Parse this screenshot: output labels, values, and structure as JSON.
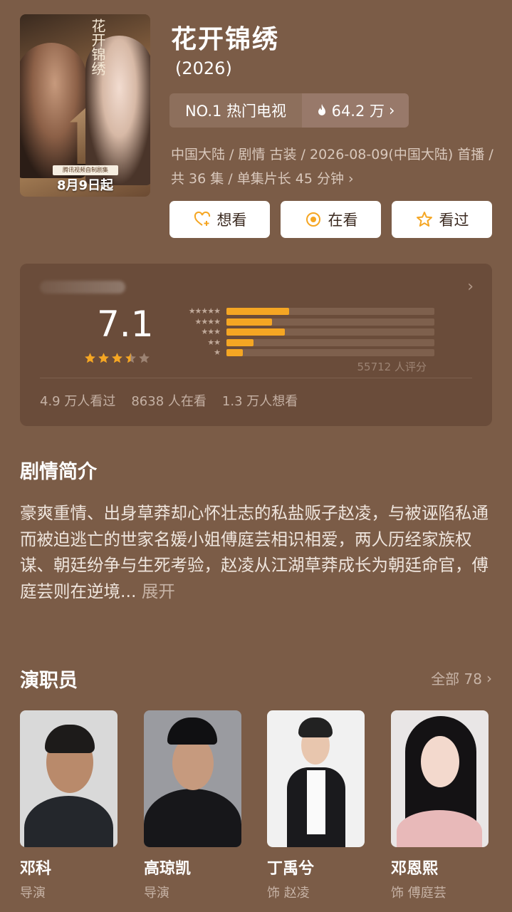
{
  "show": {
    "title": "花开锦绣",
    "year": "(2026)",
    "poster": {
      "calligraphy": "花开锦绣",
      "stripe": "腾讯视频自制剧集",
      "airdate": "8月9日起"
    },
    "rank_label": "NO.1 热门电视",
    "heat_value": "64.2 万",
    "meta_line": "中国大陆 / 剧情 古装 / 2026-08-09(中国大陆) 首播 / 共 36 集 / 单集片长 45 分钟"
  },
  "actions": {
    "want": "想看",
    "watching": "在看",
    "watched": "看过"
  },
  "rating": {
    "score": "7.1",
    "stars_filled": 3.5,
    "distribution": [
      {
        "stars": "★★★★★",
        "fraction": 0.3
      },
      {
        "stars": "★★★★",
        "fraction": 0.22
      },
      {
        "stars": "★★★",
        "fraction": 0.28
      },
      {
        "stars": "★★",
        "fraction": 0.13
      },
      {
        "stars": "★",
        "fraction": 0.08
      }
    ],
    "count": "55712 人评分",
    "seen": "4.9 万人看过",
    "watching": "8638 人在看",
    "want": "1.3 万人想看"
  },
  "synopsis": {
    "title": "剧情简介",
    "text": "豪爽重情、出身草莽却心怀壮志的私盐贩子赵凌，与被诬陷私通而被迫逃亡的世家名媛小姐傅庭芸相识相爱，两人历经家族权谋、朝廷纷争与生死考验，赵凌从江湖草莽成长为朝廷命官，傅庭芸则在逆境...",
    "expand": "展开"
  },
  "cast": {
    "title": "演职员",
    "all": "全部 78",
    "members": [
      {
        "name": "邓科",
        "role": "导演"
      },
      {
        "name": "高琼凯",
        "role": "导演"
      },
      {
        "name": "丁禹兮",
        "role": "饰 赵凌"
      },
      {
        "name": "邓恩熙",
        "role": "饰 傅庭芸"
      }
    ]
  },
  "colors": {
    "background": "#7b5c47",
    "card": "#6a4c3a",
    "accent": "#f5a623"
  }
}
